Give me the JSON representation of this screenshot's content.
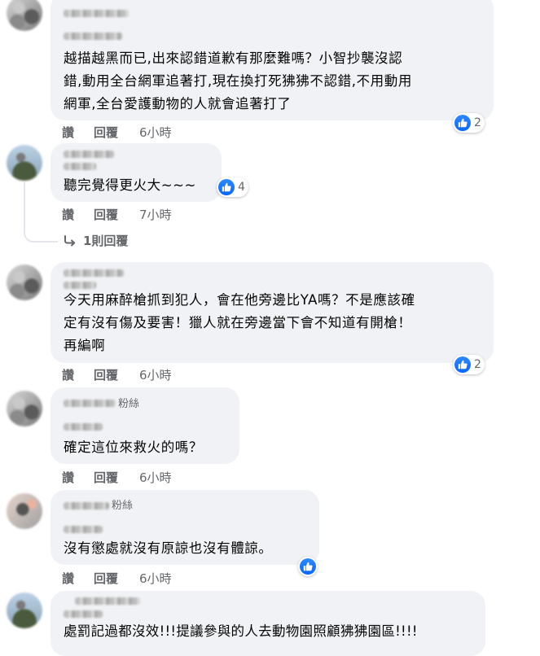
{
  "comments": [
    {
      "text": "越描越黑而已,出來認錯道歉有那麼難嗎？小智抄襲沒認錯,動用全台網軍追著打,現在換打死狒狒不認錯,不用動用網軍,全台愛護動物的人就會追著打了",
      "line1": "越描越黑而已,出來認錯道歉有那麼難嗎？小智抄襲沒認",
      "line2": "錯,動用全台網軍追著打,現在換打死狒狒不認錯,不用動用",
      "line3": "網軍,全台愛護動物的人就會追著打了",
      "like_label": "讚",
      "reply_label": "回覆",
      "time": "6小時",
      "reaction_count": "2"
    },
    {
      "text": "聽完覺得更火大~~~",
      "like_label": "讚",
      "reply_label": "回覆",
      "time": "7小時",
      "reaction_count": "4",
      "replies_link": "1則回覆"
    },
    {
      "line1": "今天用麻醉槍抓到犯人，會在他旁邊比YA嗎？不是應該確",
      "line2": "定有沒有傷及要害！獵人就在旁邊當下會不知道有開槍！",
      "line3": "再編啊",
      "like_label": "讚",
      "reply_label": "回覆",
      "time": "6小時",
      "reaction_count": "2"
    },
    {
      "name_suffix": "粉絲",
      "text": "確定這位來救火的嗎？",
      "like_label": "讚",
      "reply_label": "回覆",
      "time": "6小時"
    },
    {
      "name_suffix": "粉絲",
      "text": "沒有懲處就沒有原諒也沒有體諒。",
      "like_label": "讚",
      "reply_label": "回覆",
      "time": "6小時"
    },
    {
      "text": "處罰記過都沒效!!!提議參與的人去動物園照顧狒狒園區!!!!"
    }
  ],
  "colors": {
    "bubble": "#f0f2f5",
    "like_blue": "#0866ff",
    "meta_gray": "#65676b"
  },
  "icons": {
    "like": "thumbs-up-icon",
    "reply_arrow": "reply-arrow-icon"
  }
}
